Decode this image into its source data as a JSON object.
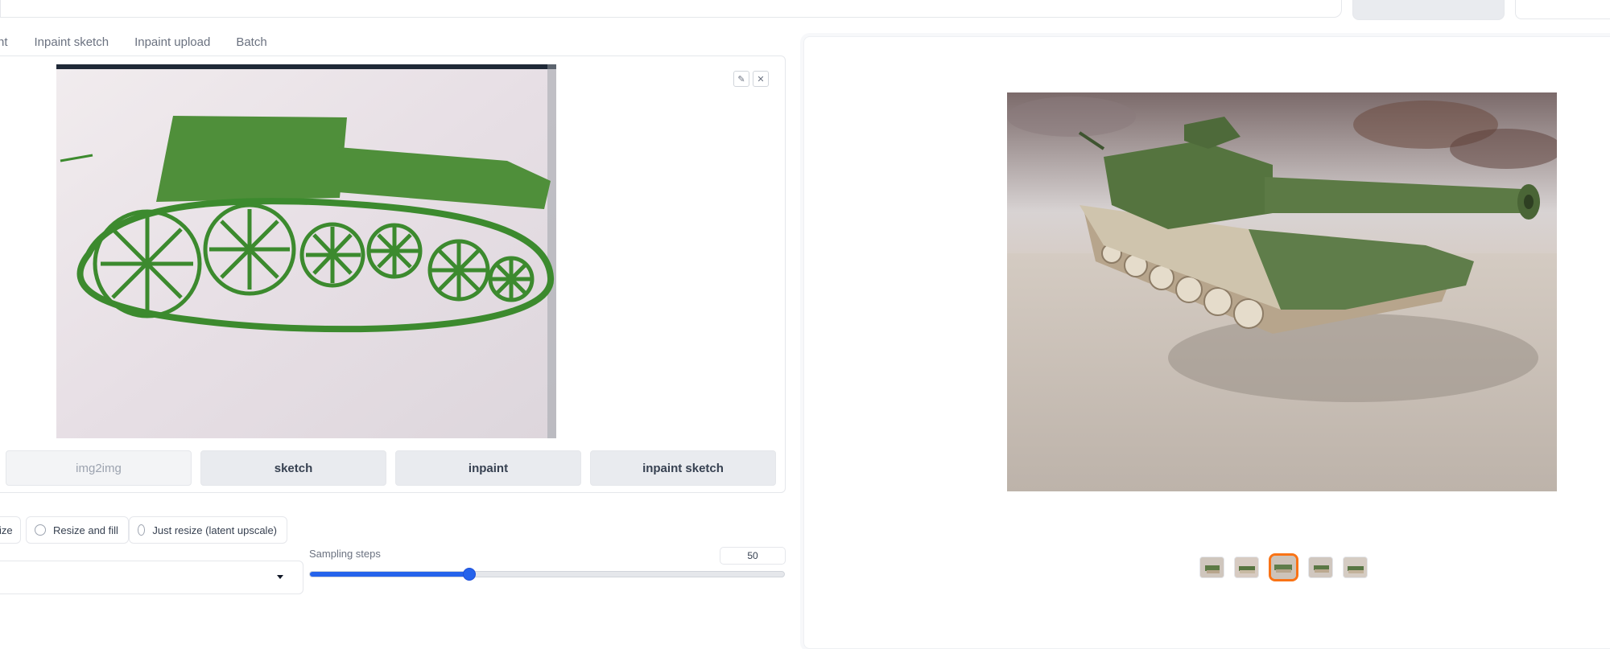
{
  "tabs": [
    {
      "label": "nt"
    },
    {
      "label": "Inpaint sketch"
    },
    {
      "label": "Inpaint upload"
    },
    {
      "label": "Batch"
    }
  ],
  "canvas_tools": {
    "edit_icon": "pencil-icon",
    "close_icon": "close-icon"
  },
  "modes": [
    {
      "label": "img2img",
      "state": "inactive"
    },
    {
      "label": "sketch"
    },
    {
      "label": "inpaint"
    },
    {
      "label": "inpaint sketch"
    }
  ],
  "resize_options": [
    {
      "label": "ize"
    },
    {
      "label": "Resize and fill"
    },
    {
      "label": "Just resize (latent upscale)"
    }
  ],
  "sampling": {
    "label": "Sampling steps",
    "value": "50",
    "fraction": 0.336
  },
  "gallery": {
    "thumbnail_count": 5,
    "selected_index": 2
  },
  "colors": {
    "accent": "#2563eb",
    "selected": "#f97316"
  }
}
